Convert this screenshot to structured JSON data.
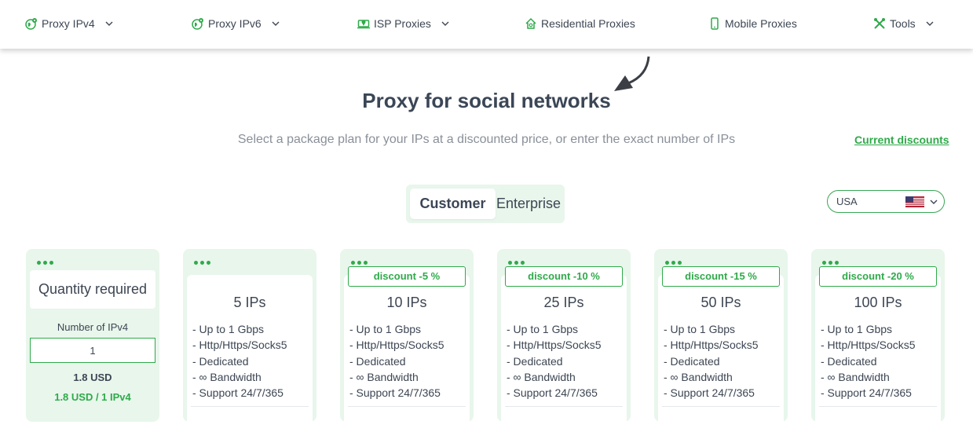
{
  "nav": {
    "items": [
      {
        "label": "Proxy IPv4",
        "icon": "globe-pin-icon",
        "dropdown": true
      },
      {
        "label": "Proxy IPv6",
        "icon": "globe-pin-icon",
        "dropdown": true
      },
      {
        "label": "ISP Proxies",
        "icon": "laptop-pin-icon",
        "dropdown": true
      },
      {
        "label": "Residential Proxies",
        "icon": "home-icon",
        "dropdown": false
      },
      {
        "label": "Mobile Proxies",
        "icon": "phone-icon",
        "dropdown": false
      },
      {
        "label": "Tools",
        "icon": "tools-icon",
        "dropdown": true
      }
    ]
  },
  "page": {
    "title": "Proxy for social networks",
    "subtitle": "Select a package plan for your IPs at a discounted price, or enter the exact number of IPs",
    "discounts_link": "Current discounts"
  },
  "toggle": {
    "active": "Customer",
    "inactive": "Enterprise"
  },
  "country": {
    "value": "USA",
    "flag": "us-flag-icon"
  },
  "custom_plan": {
    "title": "Quantity required",
    "input_label": "Number of IPv4",
    "input_value": "1",
    "price": "1.8 USD",
    "per_ip": "1.8 USD / 1 IPv4"
  },
  "plans": [
    {
      "badge": "",
      "qty": "5 IPs"
    },
    {
      "badge": "discount -5 %",
      "qty": "10 IPs"
    },
    {
      "badge": "discount -10 %",
      "qty": "25 IPs"
    },
    {
      "badge": "discount -15 %",
      "qty": "50 IPs"
    },
    {
      "badge": "discount -20 %",
      "qty": "100 IPs"
    }
  ],
  "features": [
    "- Up to 1 Gbps",
    "- Http/Https/Socks5",
    "- Dedicated",
    "- ∞ Bandwidth",
    "- Support 24/7/365"
  ],
  "colors": {
    "accent": "#2faa4a",
    "card_bg": "#e8f6ec",
    "text": "#3d4653",
    "muted": "#8a9099"
  }
}
